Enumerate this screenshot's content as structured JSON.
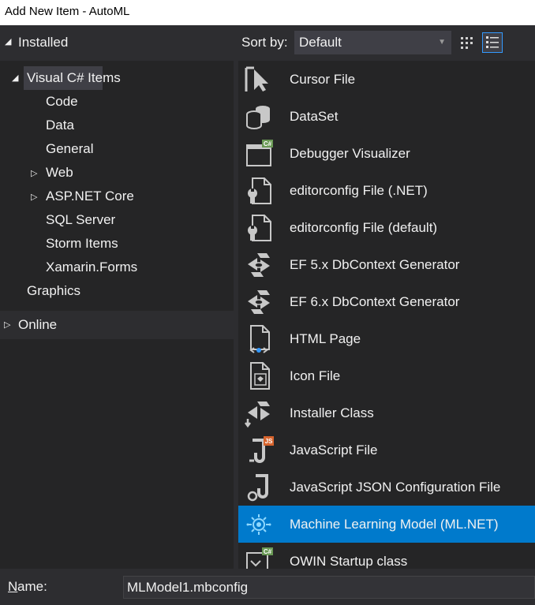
{
  "window": {
    "title": "Add New Item - AutoML"
  },
  "tree": {
    "installed": "Installed",
    "visual_csharp": "Visual C# Items",
    "children": [
      "Code",
      "Data",
      "General",
      "Web",
      "ASP.NET Core",
      "SQL Server",
      "Storm Items",
      "Xamarin.Forms"
    ],
    "graphics": "Graphics",
    "online": "Online"
  },
  "sort": {
    "label": "Sort by:",
    "value": "Default"
  },
  "templates": [
    {
      "label": "Cursor File",
      "icon": "cursor-file-icon"
    },
    {
      "label": "DataSet",
      "icon": "dataset-icon"
    },
    {
      "label": "Debugger Visualizer",
      "icon": "debugger-visualizer-icon"
    },
    {
      "label": "editorconfig File (.NET)",
      "icon": "editorconfig-icon"
    },
    {
      "label": "editorconfig File (default)",
      "icon": "editorconfig-icon"
    },
    {
      "label": "EF 5.x DbContext Generator",
      "icon": "ef-generator-icon"
    },
    {
      "label": "EF 6.x DbContext Generator",
      "icon": "ef-generator-icon"
    },
    {
      "label": "HTML Page",
      "icon": "html-page-icon"
    },
    {
      "label": "Icon File",
      "icon": "icon-file-icon"
    },
    {
      "label": "Installer Class",
      "icon": "installer-class-icon"
    },
    {
      "label": "JavaScript File",
      "icon": "javascript-file-icon"
    },
    {
      "label": "JavaScript JSON Configuration File",
      "icon": "json-config-icon"
    },
    {
      "label": "Machine Learning Model (ML.NET)",
      "icon": "ml-model-icon",
      "selected": true
    },
    {
      "label": "OWIN Startup class",
      "icon": "owin-startup-icon"
    }
  ],
  "name_field": {
    "label_accel": "N",
    "label_rest": "ame:",
    "value": "MLModel1.mbconfig"
  },
  "colors": {
    "accent": "#007acc",
    "panel": "#252526",
    "chrome": "#2d2d30"
  }
}
